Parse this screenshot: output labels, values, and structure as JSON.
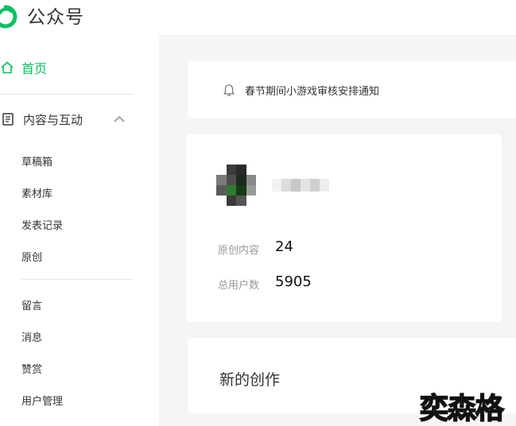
{
  "app": {
    "title": "公众号",
    "brand_color": "#07c160"
  },
  "sidebar": {
    "home_label": "首页",
    "group_label": "内容与互动",
    "items": [
      "草稿箱",
      "素材库",
      "发表记录",
      "原创",
      "留言",
      "消息",
      "赞赏",
      "用户管理"
    ]
  },
  "notice": {
    "text": "春节期间小游戏审核安排通知",
    "icon": "bell-icon"
  },
  "account": {
    "stats": [
      {
        "label": "原创内容",
        "value": "24"
      },
      {
        "label": "总用户数",
        "value": "5905"
      }
    ]
  },
  "create": {
    "title": "新的创作"
  },
  "watermark": "奕森格"
}
